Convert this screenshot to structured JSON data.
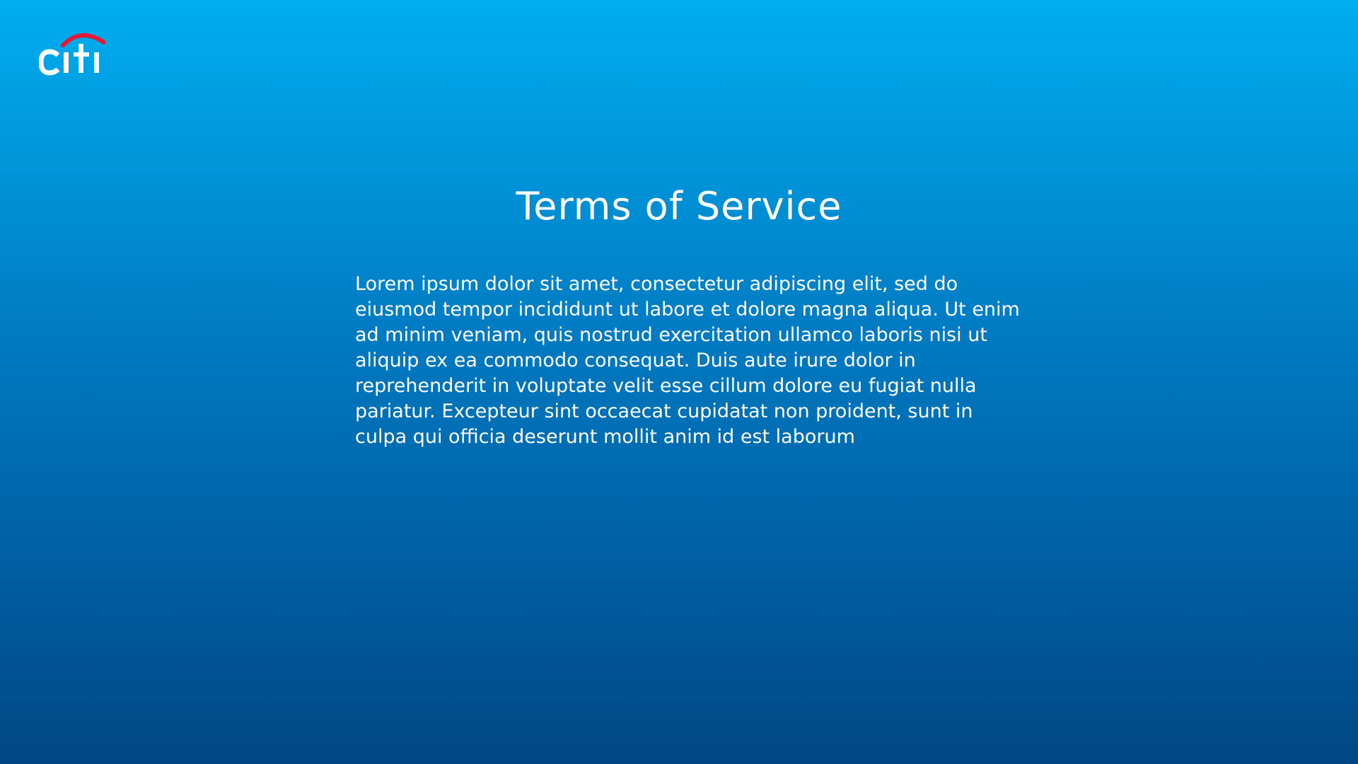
{
  "brand": {
    "logo_text": "citi",
    "arc_color": "#e31837",
    "text_color": "#ffffff"
  },
  "background": {
    "top_color": "#00aeef",
    "bottom_color": "#004785"
  },
  "page": {
    "title": "Terms of Service",
    "body": "Lorem ipsum dolor sit amet, consectetur adipiscing elit, sed do eiusmod tempor incididunt ut labore et dolore magna aliqua. Ut enim ad minim veniam, quis nostrud exercitation ullamco laboris nisi ut aliquip ex ea commodo consequat. Duis aute irure dolor in reprehenderit in voluptate velit esse cillum dolore eu fugiat nulla pariatur. Excepteur sint occaecat cupidatat non proident, sunt in culpa qui officia deserunt mollit anim id est laborum"
  }
}
